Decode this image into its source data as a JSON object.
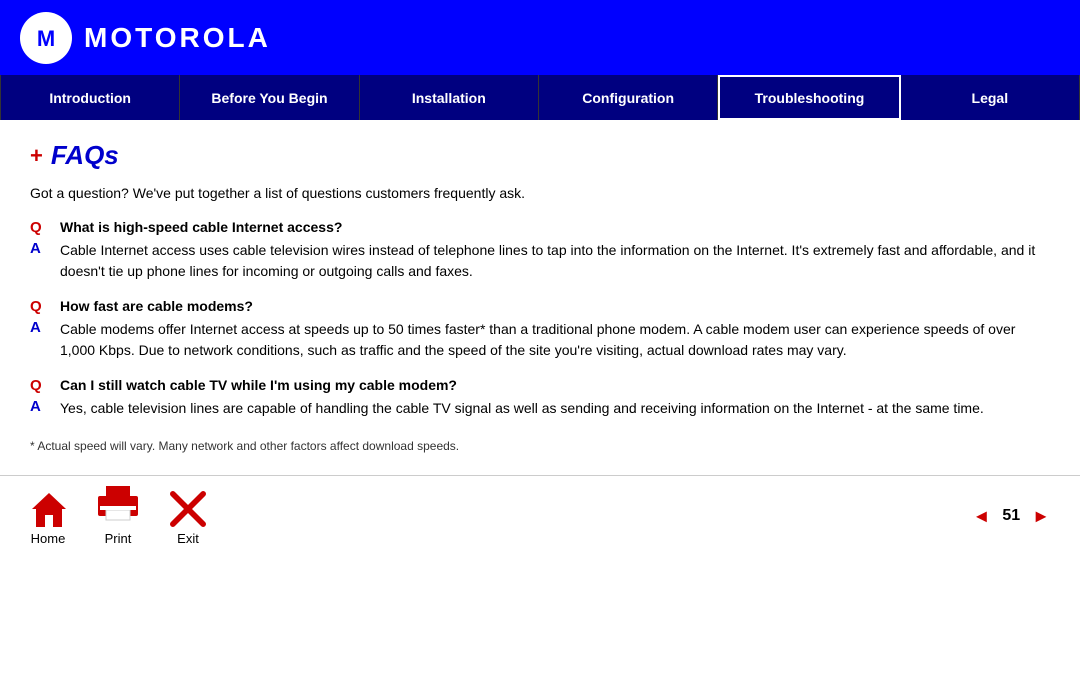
{
  "header": {
    "brand": "MOTOROLA",
    "logo_text": "M"
  },
  "navbar": {
    "items": [
      {
        "label": "Introduction",
        "active": false
      },
      {
        "label": "Before You Begin",
        "active": false
      },
      {
        "label": "Installation",
        "active": false
      },
      {
        "label": "Configuration",
        "active": false
      },
      {
        "label": "Troubleshooting",
        "active": true
      },
      {
        "label": "Legal",
        "active": false
      }
    ]
  },
  "page": {
    "section_icon": "+",
    "section_title": "FAQs",
    "intro": "Got a question? We've put together a list of questions customers frequently ask.",
    "faqs": [
      {
        "q_label": "Q",
        "a_label": "A",
        "question": "What is high-speed cable Internet access?",
        "answer": "Cable Internet access uses cable television wires instead of telephone lines to tap into the information on the Internet. It's extremely fast and affordable, and it doesn't tie up phone lines for incoming or outgoing calls and faxes."
      },
      {
        "q_label": "Q",
        "a_label": "A",
        "question": "How fast are cable modems?",
        "answer": "Cable modems offer Internet access at speeds up to 50 times faster* than a traditional phone modem. A cable modem user can experience speeds of over 1,000 Kbps. Due to network conditions, such as traffic and the speed of the site you're visiting, actual download rates may vary."
      },
      {
        "q_label": "Q",
        "a_label": "A",
        "question": "Can I still watch cable TV while I'm using my cable modem?",
        "answer": "Yes, cable television lines are capable of handling the cable TV signal as well as sending and receiving information on the Internet - at the same time."
      }
    ],
    "footnote": "* Actual speed will vary. Many network and other factors affect download speeds.",
    "bottom": {
      "home_label": "Home",
      "print_label": "Print",
      "exit_label": "Exit",
      "page_number": "51",
      "prev_arrow": "◄",
      "next_arrow": "►"
    }
  }
}
